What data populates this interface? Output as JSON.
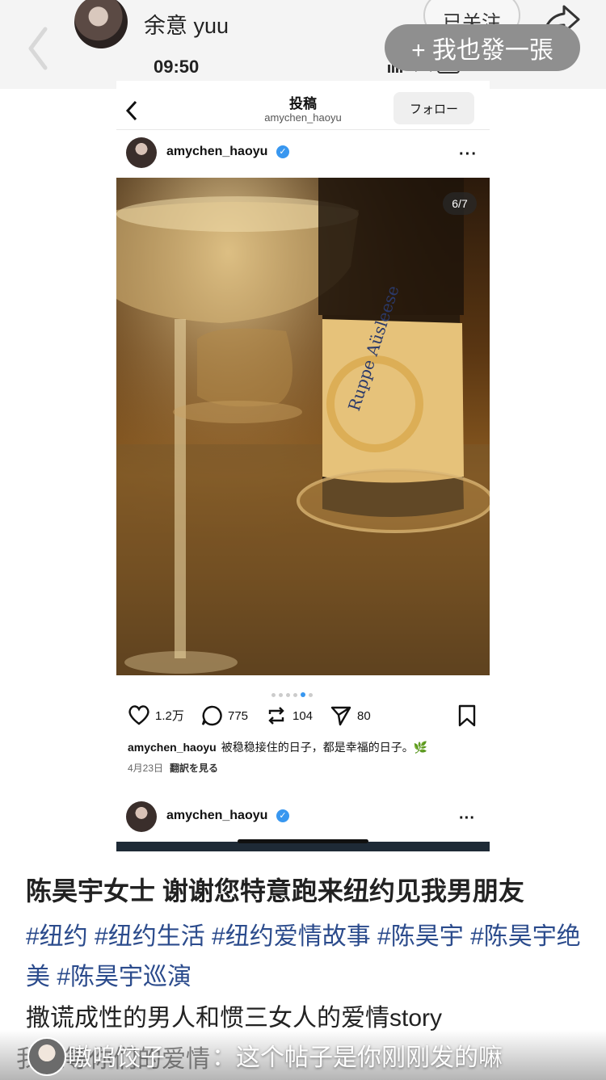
{
  "header": {
    "author_name": "余意 yuu",
    "follow_label": "已关注",
    "post_too_label": "+ 我也發一張",
    "status_time": "09:50",
    "status_battery": "26"
  },
  "embed": {
    "title": "投稿",
    "handle": "amychen_haoyu",
    "follow_label": "フォロー",
    "username": "amychen_haoyu",
    "photo_counter": "6/7",
    "likes": "1.2万",
    "comments": "775",
    "reposts": "104",
    "shares": "80",
    "caption_user": "amychen_haoyu",
    "caption_text": "被稳稳接住的日子，都是幸福的日子。🌿",
    "date": "4月23日",
    "translate": "翻訳を見る",
    "username2": "amychen_haoyu",
    "bottle_label": "Ruppe Aüsleese"
  },
  "post": {
    "headline": "陈昊宇女士 谢谢您特意跑来纽约见我男朋友",
    "tags": "#纽约 #纽约生活 #纽约爱情故事 #陈昊宇 #陈昊宇绝美 #陈昊宇巡演",
    "body": "撒谎成性的男人和惯三女人的爱情story",
    "hidden_line": "我就等你们的爱情"
  },
  "comment": {
    "user": "嗷呜饺子",
    "text": "：这个帖子是你刚刚发的嘛"
  }
}
